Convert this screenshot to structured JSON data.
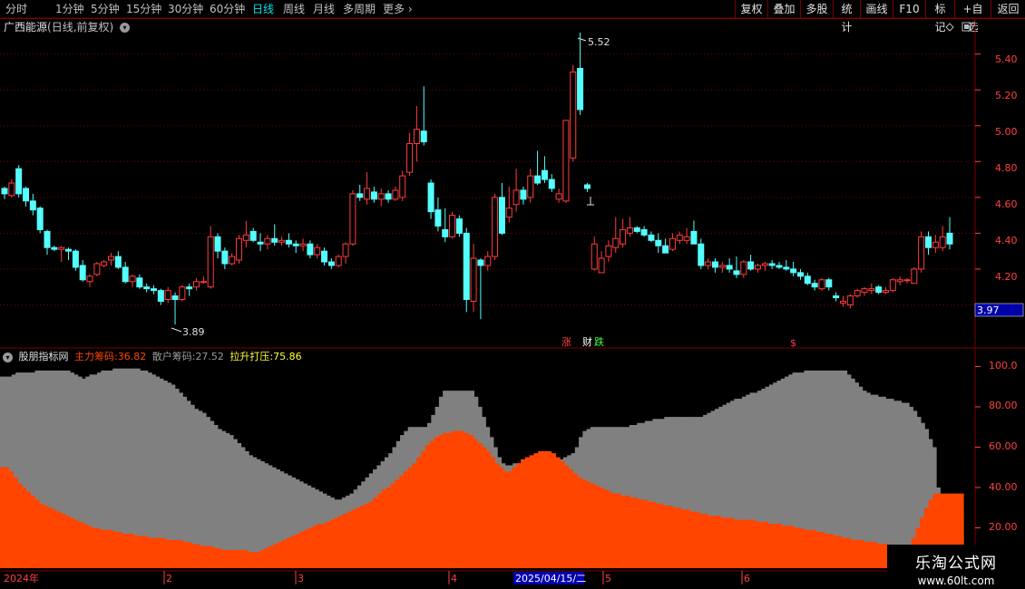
{
  "toolbar": {
    "periods": [
      "分时",
      "1分钟",
      "5分钟",
      "15分钟",
      "30分钟",
      "60分钟",
      "日线",
      "周线",
      "月线",
      "多周期"
    ],
    "active_period": "日线",
    "more_label": "更多",
    "right_buttons": [
      "复权",
      "叠加",
      "多股",
      "统计",
      "画线",
      "F10",
      "标记",
      "+自选",
      "返回"
    ]
  },
  "title": {
    "stock_name": "广西能源",
    "mode": "(日线,前复权)",
    "dropdown_icon": "chevron-down-icon"
  },
  "price_axis": {
    "ticks": [
      "5.40",
      "5.20",
      "5.00",
      "4.80",
      "4.60",
      "4.40",
      "4.20"
    ],
    "current_price": "3.97"
  },
  "price_annotations": {
    "high_label": "5.52",
    "low_label": "3.89"
  },
  "event_markers": {
    "limit_up": "涨",
    "finance": "财",
    "limit_down": "跌",
    "dollar": "$"
  },
  "indicator": {
    "name": "股朋指标网",
    "main_label": "主力筹码:",
    "main_value": "36.82",
    "retail_label": "散户筹码:",
    "retail_value": "27.52",
    "pull_label": "拉升打压:",
    "pull_value": "75.86",
    "axis_ticks": [
      "100.0",
      "80.00",
      "60.00",
      "40.00",
      "20.00"
    ]
  },
  "date_axis": {
    "labels": [
      "2024年",
      "2",
      "3",
      "4",
      "5",
      "6"
    ],
    "cursor_date": "2025/04/15/二"
  },
  "watermark": {
    "line1": "乐淘公式网",
    "line2": "www.60lt.com"
  },
  "colors": {
    "up": "#ff3c3c",
    "down": "#54ffff",
    "main_chips": "#ff4500",
    "retail_chips": "#808080",
    "pull_line": "#ffff33",
    "grid": "#7a0000"
  },
  "chart_data": {
    "type": "candlestick",
    "price_range": [
      3.8,
      5.55
    ],
    "candles": [
      {
        "o": 4.65,
        "h": 4.66,
        "l": 4.59,
        "c": 4.62
      },
      {
        "o": 4.61,
        "h": 4.7,
        "l": 4.6,
        "c": 4.68
      },
      {
        "o": 4.76,
        "h": 4.78,
        "l": 4.6,
        "c": 4.62
      },
      {
        "o": 4.65,
        "h": 4.66,
        "l": 4.55,
        "c": 4.58
      },
      {
        "o": 4.58,
        "h": 4.62,
        "l": 4.5,
        "c": 4.53
      },
      {
        "o": 4.54,
        "h": 4.55,
        "l": 4.4,
        "c": 4.42
      },
      {
        "o": 4.41,
        "h": 4.42,
        "l": 4.28,
        "c": 4.32
      },
      {
        "o": 4.32,
        "h": 4.33,
        "l": 4.3,
        "c": 4.31
      },
      {
        "o": 4.31,
        "h": 4.33,
        "l": 4.24,
        "c": 4.32
      },
      {
        "o": 4.31,
        "h": 4.32,
        "l": 4.25,
        "c": 4.3
      },
      {
        "o": 4.3,
        "h": 4.31,
        "l": 4.19,
        "c": 4.21
      },
      {
        "o": 4.22,
        "h": 4.25,
        "l": 4.13,
        "c": 4.14
      },
      {
        "o": 4.13,
        "h": 4.17,
        "l": 4.1,
        "c": 4.16
      },
      {
        "o": 4.17,
        "h": 4.24,
        "l": 4.16,
        "c": 4.23
      },
      {
        "o": 4.22,
        "h": 4.25,
        "l": 4.21,
        "c": 4.24
      },
      {
        "o": 4.25,
        "h": 4.29,
        "l": 4.22,
        "c": 4.27
      },
      {
        "o": 4.27,
        "h": 4.3,
        "l": 4.2,
        "c": 4.21
      },
      {
        "o": 4.21,
        "h": 4.24,
        "l": 4.12,
        "c": 4.13
      },
      {
        "o": 4.13,
        "h": 4.17,
        "l": 4.1,
        "c": 4.16
      },
      {
        "o": 4.15,
        "h": 4.17,
        "l": 4.09,
        "c": 4.1
      },
      {
        "o": 4.1,
        "h": 4.12,
        "l": 4.07,
        "c": 4.09
      },
      {
        "o": 4.09,
        "h": 4.11,
        "l": 4.06,
        "c": 4.08
      },
      {
        "o": 4.08,
        "h": 4.09,
        "l": 4.0,
        "c": 4.02
      },
      {
        "o": 4.03,
        "h": 4.1,
        "l": 4.01,
        "c": 4.08
      },
      {
        "o": 4.05,
        "h": 4.07,
        "l": 3.89,
        "c": 4.03
      },
      {
        "o": 4.03,
        "h": 4.11,
        "l": 4.02,
        "c": 4.1
      },
      {
        "o": 4.1,
        "h": 4.12,
        "l": 4.05,
        "c": 4.09
      },
      {
        "o": 4.1,
        "h": 4.15,
        "l": 4.08,
        "c": 4.13
      },
      {
        "o": 4.13,
        "h": 4.16,
        "l": 4.12,
        "c": 4.13
      },
      {
        "o": 4.1,
        "h": 4.44,
        "l": 4.09,
        "c": 4.38
      },
      {
        "o": 4.38,
        "h": 4.4,
        "l": 4.26,
        "c": 4.3
      },
      {
        "o": 4.3,
        "h": 4.32,
        "l": 4.2,
        "c": 4.23
      },
      {
        "o": 4.23,
        "h": 4.29,
        "l": 4.22,
        "c": 4.27
      },
      {
        "o": 4.25,
        "h": 4.39,
        "l": 4.23,
        "c": 4.37
      },
      {
        "o": 4.36,
        "h": 4.47,
        "l": 4.32,
        "c": 4.39
      },
      {
        "o": 4.41,
        "h": 4.43,
        "l": 4.35,
        "c": 4.36
      },
      {
        "o": 4.35,
        "h": 4.4,
        "l": 4.3,
        "c": 4.34
      },
      {
        "o": 4.34,
        "h": 4.39,
        "l": 4.31,
        "c": 4.37
      },
      {
        "o": 4.37,
        "h": 4.45,
        "l": 4.33,
        "c": 4.35
      },
      {
        "o": 4.35,
        "h": 4.38,
        "l": 4.33,
        "c": 4.36
      },
      {
        "o": 4.36,
        "h": 4.4,
        "l": 4.32,
        "c": 4.34
      },
      {
        "o": 4.34,
        "h": 4.36,
        "l": 4.29,
        "c": 4.33
      },
      {
        "o": 4.33,
        "h": 4.37,
        "l": 4.3,
        "c": 4.34
      },
      {
        "o": 4.34,
        "h": 4.36,
        "l": 4.26,
        "c": 4.28
      },
      {
        "o": 4.28,
        "h": 4.34,
        "l": 4.26,
        "c": 4.32
      },
      {
        "o": 4.3,
        "h": 4.32,
        "l": 4.22,
        "c": 4.24
      },
      {
        "o": 4.24,
        "h": 4.26,
        "l": 4.2,
        "c": 4.22
      },
      {
        "o": 4.22,
        "h": 4.28,
        "l": 4.21,
        "c": 4.27
      },
      {
        "o": 4.27,
        "h": 4.35,
        "l": 4.23,
        "c": 4.34
      },
      {
        "o": 4.34,
        "h": 4.64,
        "l": 4.33,
        "c": 4.62
      },
      {
        "o": 4.62,
        "h": 4.67,
        "l": 4.58,
        "c": 4.6
      },
      {
        "o": 4.59,
        "h": 4.74,
        "l": 4.56,
        "c": 4.65
      },
      {
        "o": 4.63,
        "h": 4.66,
        "l": 4.57,
        "c": 4.59
      },
      {
        "o": 4.59,
        "h": 4.65,
        "l": 4.55,
        "c": 4.62
      },
      {
        "o": 4.62,
        "h": 4.64,
        "l": 4.57,
        "c": 4.59
      },
      {
        "o": 4.59,
        "h": 4.66,
        "l": 4.58,
        "c": 4.64
      },
      {
        "o": 4.6,
        "h": 4.75,
        "l": 4.58,
        "c": 4.72
      },
      {
        "o": 4.74,
        "h": 4.96,
        "l": 4.72,
        "c": 4.9
      },
      {
        "o": 4.9,
        "h": 5.11,
        "l": 4.8,
        "c": 4.98
      },
      {
        "o": 4.97,
        "h": 5.22,
        "l": 4.89,
        "c": 4.91
      },
      {
        "o": 4.68,
        "h": 4.7,
        "l": 4.48,
        "c": 4.52
      },
      {
        "o": 4.53,
        "h": 4.6,
        "l": 4.41,
        "c": 4.44
      },
      {
        "o": 4.42,
        "h": 4.54,
        "l": 4.35,
        "c": 4.38
      },
      {
        "o": 4.38,
        "h": 4.52,
        "l": 4.37,
        "c": 4.5
      },
      {
        "o": 4.48,
        "h": 4.5,
        "l": 4.38,
        "c": 4.4
      },
      {
        "o": 4.4,
        "h": 4.43,
        "l": 3.96,
        "c": 4.03
      },
      {
        "o": 4.02,
        "h": 4.34,
        "l": 3.96,
        "c": 4.26
      },
      {
        "o": 4.25,
        "h": 4.26,
        "l": 3.92,
        "c": 4.22
      },
      {
        "o": 4.22,
        "h": 4.3,
        "l": 4.19,
        "c": 4.27
      },
      {
        "o": 4.27,
        "h": 4.62,
        "l": 4.25,
        "c": 4.6
      },
      {
        "o": 4.6,
        "h": 4.68,
        "l": 4.39,
        "c": 4.4
      },
      {
        "o": 4.49,
        "h": 4.66,
        "l": 4.46,
        "c": 4.54
      },
      {
        "o": 4.56,
        "h": 4.76,
        "l": 4.52,
        "c": 4.64
      },
      {
        "o": 4.64,
        "h": 4.66,
        "l": 4.56,
        "c": 4.59
      },
      {
        "o": 4.6,
        "h": 4.76,
        "l": 4.57,
        "c": 4.72
      },
      {
        "o": 4.72,
        "h": 4.86,
        "l": 4.67,
        "c": 4.68
      },
      {
        "o": 4.75,
        "h": 4.83,
        "l": 4.68,
        "c": 4.7
      },
      {
        "o": 4.7,
        "h": 4.73,
        "l": 4.63,
        "c": 4.65
      },
      {
        "o": 4.59,
        "h": 4.65,
        "l": 4.57,
        "c": 4.62
      },
      {
        "o": 4.58,
        "h": 4.99,
        "l": 4.57,
        "c": 5.03
      },
      {
        "o": 4.82,
        "h": 5.34,
        "l": 4.8,
        "c": 5.3
      },
      {
        "o": 5.32,
        "h": 5.52,
        "l": 5.06,
        "c": 5.09
      },
      {
        "o": 4.67,
        "h": 4.68,
        "l": 4.63,
        "c": 4.65
      },
      {
        "o": 4.2,
        "h": 4.38,
        "l": 4.19,
        "c": 4.34
      },
      {
        "o": 4.18,
        "h": 4.3,
        "l": 4.18,
        "c": 4.26
      },
      {
        "o": 4.27,
        "h": 4.36,
        "l": 4.24,
        "c": 4.33
      },
      {
        "o": 4.32,
        "h": 4.49,
        "l": 4.29,
        "c": 4.37
      },
      {
        "o": 4.34,
        "h": 4.48,
        "l": 4.32,
        "c": 4.42
      },
      {
        "o": 4.4,
        "h": 4.49,
        "l": 4.38,
        "c": 4.43
      },
      {
        "o": 4.43,
        "h": 4.44,
        "l": 4.4,
        "c": 4.41
      },
      {
        "o": 4.42,
        "h": 4.44,
        "l": 4.38,
        "c": 4.39
      },
      {
        "o": 4.39,
        "h": 4.41,
        "l": 4.35,
        "c": 4.36
      },
      {
        "o": 4.36,
        "h": 4.4,
        "l": 4.29,
        "c": 4.33
      },
      {
        "o": 4.33,
        "h": 4.37,
        "l": 4.29,
        "c": 4.29
      },
      {
        "o": 4.31,
        "h": 4.4,
        "l": 4.3,
        "c": 4.37
      },
      {
        "o": 4.36,
        "h": 4.41,
        "l": 4.34,
        "c": 4.39
      },
      {
        "o": 4.36,
        "h": 4.43,
        "l": 4.34,
        "c": 4.38
      },
      {
        "o": 4.41,
        "h": 4.47,
        "l": 4.36,
        "c": 4.34
      },
      {
        "o": 4.34,
        "h": 4.37,
        "l": 4.2,
        "c": 4.22
      },
      {
        "o": 4.22,
        "h": 4.26,
        "l": 4.2,
        "c": 4.24
      },
      {
        "o": 4.24,
        "h": 4.26,
        "l": 4.18,
        "c": 4.21
      },
      {
        "o": 4.21,
        "h": 4.24,
        "l": 4.18,
        "c": 4.22
      },
      {
        "o": 4.22,
        "h": 4.26,
        "l": 4.18,
        "c": 4.2
      },
      {
        "o": 4.19,
        "h": 4.27,
        "l": 4.15,
        "c": 4.17
      },
      {
        "o": 4.17,
        "h": 4.25,
        "l": 4.15,
        "c": 4.24
      },
      {
        "o": 4.24,
        "h": 4.28,
        "l": 4.19,
        "c": 4.2
      },
      {
        "o": 4.2,
        "h": 4.23,
        "l": 4.18,
        "c": 4.22
      },
      {
        "o": 4.22,
        "h": 4.24,
        "l": 4.19,
        "c": 4.23
      },
      {
        "o": 4.23,
        "h": 4.25,
        "l": 4.2,
        "c": 4.22
      },
      {
        "o": 4.22,
        "h": 4.24,
        "l": 4.2,
        "c": 4.21
      },
      {
        "o": 4.21,
        "h": 4.25,
        "l": 4.19,
        "c": 4.2
      },
      {
        "o": 4.2,
        "h": 4.24,
        "l": 4.16,
        "c": 4.18
      },
      {
        "o": 4.18,
        "h": 4.2,
        "l": 4.14,
        "c": 4.16
      },
      {
        "o": 4.16,
        "h": 4.18,
        "l": 4.11,
        "c": 4.12
      },
      {
        "o": 4.12,
        "h": 4.14,
        "l": 4.08,
        "c": 4.1
      },
      {
        "o": 4.09,
        "h": 4.15,
        "l": 4.08,
        "c": 4.14
      },
      {
        "o": 4.14,
        "h": 4.15,
        "l": 4.08,
        "c": 4.1
      },
      {
        "o": 4.05,
        "h": 4.07,
        "l": 4.02,
        "c": 4.04
      },
      {
        "o": 4.01,
        "h": 4.05,
        "l": 3.99,
        "c": 4.02
      },
      {
        "o": 4.0,
        "h": 4.06,
        "l": 3.98,
        "c": 4.05
      },
      {
        "o": 4.05,
        "h": 4.09,
        "l": 4.04,
        "c": 4.08
      },
      {
        "o": 4.07,
        "h": 4.1,
        "l": 4.05,
        "c": 4.09
      },
      {
        "o": 4.08,
        "h": 4.12,
        "l": 4.06,
        "c": 4.09
      },
      {
        "o": 4.1,
        "h": 4.11,
        "l": 4.06,
        "c": 4.07
      },
      {
        "o": 4.07,
        "h": 4.1,
        "l": 4.06,
        "c": 4.08
      },
      {
        "o": 4.08,
        "h": 4.15,
        "l": 4.07,
        "c": 4.14
      },
      {
        "o": 4.13,
        "h": 4.16,
        "l": 4.11,
        "c": 4.14
      },
      {
        "o": 4.14,
        "h": 4.15,
        "l": 4.12,
        "c": 4.14
      },
      {
        "o": 4.12,
        "h": 4.21,
        "l": 4.12,
        "c": 4.2
      },
      {
        "o": 4.2,
        "h": 4.41,
        "l": 4.18,
        "c": 4.38
      },
      {
        "o": 4.38,
        "h": 4.41,
        "l": 4.28,
        "c": 4.32
      },
      {
        "o": 4.32,
        "h": 4.39,
        "l": 4.29,
        "c": 4.35
      },
      {
        "o": 4.32,
        "h": 4.44,
        "l": 4.3,
        "c": 4.38
      },
      {
        "o": 4.4,
        "h": 4.49,
        "l": 4.31,
        "c": 4.34
      }
    ],
    "main_chips": [
      50,
      50,
      48,
      45,
      42,
      40,
      38,
      36,
      34,
      32,
      31,
      30,
      29,
      28,
      27,
      26,
      25,
      24,
      23,
      22,
      21,
      20,
      20,
      19,
      19,
      19,
      18,
      18,
      17,
      17,
      17,
      16,
      16,
      16,
      15,
      15,
      15,
      15,
      14,
      14,
      14,
      14,
      13,
      13,
      12,
      12,
      11,
      11,
      11,
      10,
      10,
      9,
      9,
      9,
      9,
      9,
      9,
      8,
      8,
      8,
      9,
      10,
      11,
      12,
      13,
      14,
      15,
      16,
      17,
      18,
      19,
      20,
      21,
      22,
      22,
      23,
      24,
      25,
      26,
      27,
      28,
      29,
      30,
      31,
      32,
      33,
      35,
      37,
      39,
      40,
      42,
      44,
      46,
      48,
      50,
      52,
      55,
      58,
      61,
      63,
      65,
      66,
      67,
      67,
      68,
      68,
      68,
      67,
      66,
      64,
      62,
      60,
      58,
      55,
      52,
      50,
      48,
      48,
      50,
      52,
      54,
      55,
      56,
      57,
      58,
      58,
      58,
      57,
      55,
      53,
      51,
      49,
      47,
      45,
      44,
      43,
      42,
      41,
      40,
      39,
      38,
      37,
      37,
      36,
      36,
      35,
      35,
      34,
      34,
      33,
      33,
      32,
      32,
      31,
      31,
      30,
      30,
      29,
      29,
      28,
      28,
      27,
      27,
      26,
      26,
      26,
      25,
      25,
      25,
      24,
      24,
      24,
      24,
      24,
      23,
      23,
      23,
      22,
      22,
      22,
      21,
      21,
      21,
      20,
      20,
      19,
      19,
      19,
      18,
      18,
      17,
      17,
      16,
      16,
      15,
      15,
      14,
      14,
      14,
      13,
      13,
      13,
      12,
      12,
      12,
      11,
      11,
      11,
      11,
      10,
      15,
      20,
      25,
      30,
      34,
      37,
      37,
      37,
      37,
      37,
      37,
      37
    ],
    "retail_chips": [
      95,
      95,
      95,
      96,
      97,
      97,
      97,
      97,
      97,
      98,
      98,
      98,
      98,
      98,
      98,
      98,
      98,
      98,
      97,
      96,
      95,
      94,
      95,
      96,
      96,
      97,
      98,
      98,
      98,
      99,
      99,
      99,
      99,
      99,
      99,
      99,
      98,
      98,
      97,
      96,
      95,
      94,
      93,
      92,
      91,
      89,
      87,
      85,
      83,
      81,
      79,
      78,
      77,
      75,
      73,
      71,
      69,
      68,
      67,
      66,
      64,
      62,
      60,
      58,
      56,
      55,
      54,
      53,
      52,
      51,
      50,
      49,
      48,
      47,
      46,
      45,
      44,
      43,
      42,
      41,
      40,
      39,
      38,
      37,
      36,
      35,
      34,
      34,
      35,
      36,
      37,
      39,
      41,
      43,
      45,
      47,
      49,
      51,
      53,
      55,
      57,
      60,
      63,
      66,
      68,
      70,
      70,
      70,
      70,
      70,
      72,
      76,
      80,
      85,
      88,
      88,
      88,
      88,
      88,
      88,
      88,
      88,
      85,
      80,
      75,
      70,
      65,
      60,
      55,
      52,
      51,
      51,
      52,
      52,
      52,
      52,
      52,
      52,
      52,
      52,
      52,
      52,
      52,
      53,
      54,
      55,
      56,
      57,
      60,
      65,
      68,
      69,
      70,
      70,
      70,
      70,
      70,
      70,
      70,
      70,
      70,
      70,
      71,
      71,
      72,
      72,
      73,
      73,
      74,
      74,
      74,
      75,
      75,
      75,
      75,
      75,
      75,
      75,
      75,
      75,
      75,
      76,
      77,
      78,
      79,
      80,
      81,
      82,
      83,
      84,
      84,
      85,
      86,
      87,
      87,
      88,
      89,
      90,
      91,
      92,
      93,
      94,
      95,
      96,
      97,
      97,
      97,
      98,
      98,
      98,
      98,
      98,
      98,
      98,
      98,
      98,
      98,
      98,
      96,
      94,
      92,
      90,
      88,
      87,
      86,
      86,
      85,
      85,
      84,
      84,
      83,
      83,
      82,
      82,
      80,
      78,
      75,
      72,
      69,
      64,
      60,
      40,
      35,
      30,
      28,
      27,
      27,
      27
    ]
  }
}
